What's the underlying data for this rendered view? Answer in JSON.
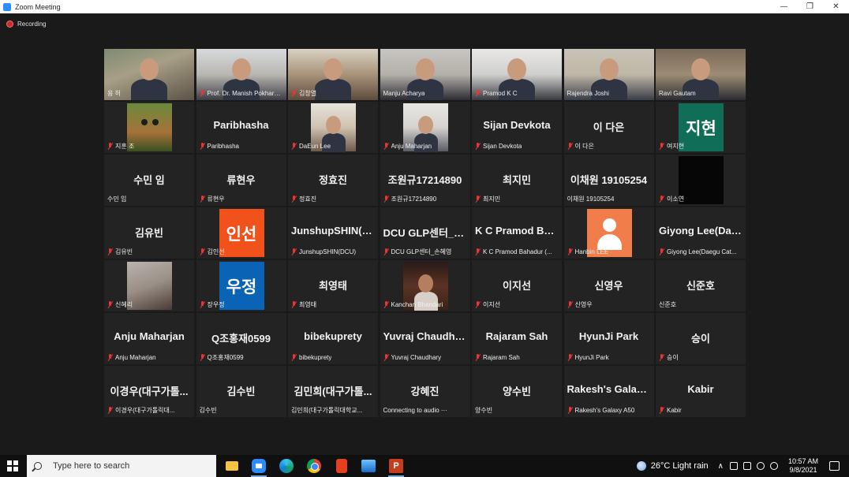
{
  "window": {
    "title": "Zoom Meeting",
    "minimize": "—",
    "restore": "❐",
    "close": "✕"
  },
  "recording": {
    "label": "Recording"
  },
  "participants": [
    {
      "name": "용 허",
      "big": "",
      "muted": false,
      "video": "v1",
      "active": true
    },
    {
      "name": "Prof. Dr. Manish Pokharel...",
      "big": "",
      "muted": true,
      "video": "v2"
    },
    {
      "name": "김창열",
      "big": "",
      "muted": true,
      "video": "v3"
    },
    {
      "name": "Manju Acharya",
      "big": "",
      "muted": false,
      "video": "v4"
    },
    {
      "name": "Pramod K C",
      "big": "",
      "muted": true,
      "video": "v5"
    },
    {
      "name": "Rajendra Joshi",
      "big": "",
      "muted": false,
      "video": "v6"
    },
    {
      "name": "Ravi Gautam",
      "big": "",
      "muted": false,
      "video": "v7"
    },
    {
      "name": "지훈 조",
      "big": "",
      "muted": true,
      "thumb": "zoot"
    },
    {
      "name": "Paribhasha",
      "big": "Paribhasha",
      "muted": true
    },
    {
      "name": "DaEun Lee",
      "big": "",
      "muted": true,
      "thumb": "daeun"
    },
    {
      "name": "Anju Maharjan",
      "big": "",
      "muted": true,
      "thumb": "anju"
    },
    {
      "name": "Sijan Devkota",
      "big": "Sijan Devkota",
      "muted": true
    },
    {
      "name": "이 다은",
      "big": "이 다은",
      "muted": true
    },
    {
      "name": "여지현",
      "big": "",
      "muted": true,
      "thumb": "jihyun",
      "thumb_text": "지현"
    },
    {
      "name": "수민 임",
      "big": "수민 임",
      "muted": false
    },
    {
      "name": "류현우",
      "big": "류현우",
      "muted": true
    },
    {
      "name": "정효진",
      "big": "정효진",
      "muted": true
    },
    {
      "name": "조원규17214890",
      "big": "조원규17214890",
      "muted": true
    },
    {
      "name": "최지민",
      "big": "최지민",
      "muted": true
    },
    {
      "name": "이채원 19105254",
      "big": "이채원 19105254",
      "muted": false
    },
    {
      "name": "이소연",
      "big": "",
      "muted": true,
      "thumb": "black"
    },
    {
      "name": "김유빈",
      "big": "김유빈",
      "muted": true
    },
    {
      "name": "김인선",
      "big": "",
      "muted": true,
      "thumb": "inseon",
      "thumb_text": "인선"
    },
    {
      "name": "JunshupSHIN(DCU)",
      "big": "JunshupSHIN(D...",
      "muted": true
    },
    {
      "name": "DCU GLP센터_손혜영",
      "big": "DCU GLP센터_손...",
      "muted": true
    },
    {
      "name": "K C Pramod Bahadur (...",
      "big": "K C Pramod Bah...",
      "muted": true
    },
    {
      "name": "Hanbin LEE",
      "big": "",
      "muted": true,
      "thumb": "hanbin"
    },
    {
      "name": "Giyong Lee(Daegu Cat...",
      "big": "Giyong Lee(Dae...",
      "muted": true
    },
    {
      "name": "신혜리",
      "big": "",
      "muted": true,
      "thumb": "shinhye"
    },
    {
      "name": "장우정",
      "big": "",
      "muted": true,
      "thumb": "ujeong",
      "thumb_text": "우정"
    },
    {
      "name": "최영태",
      "big": "최영태",
      "muted": true
    },
    {
      "name": "Kanchan Bhandari",
      "big": "",
      "muted": true,
      "thumb": "kanchan"
    },
    {
      "name": "이지선",
      "big": "이지선",
      "muted": true
    },
    {
      "name": "신영우",
      "big": "신영우",
      "muted": true
    },
    {
      "name": "신준호",
      "big": "신준호",
      "muted": false
    },
    {
      "name": "Anju Maharjan",
      "big": "Anju Maharjan",
      "muted": true
    },
    {
      "name": "Q조홍재0599",
      "big": "Q조홍재0599",
      "muted": true
    },
    {
      "name": "bibekuprety",
      "big": "bibekuprety",
      "muted": true
    },
    {
      "name": "Yuvraj Chaudhary",
      "big": "Yuvraj Chaudhary",
      "muted": true
    },
    {
      "name": "Rajaram Sah",
      "big": "Rajaram Sah",
      "muted": true
    },
    {
      "name": "HyunJi Park",
      "big": "HyunJi Park",
      "muted": true
    },
    {
      "name": "승이",
      "big": "승이",
      "muted": true
    },
    {
      "name": "이경우(대구가톨릭대...",
      "big": "이경우(대구가톨...",
      "muted": true
    },
    {
      "name": "김수빈",
      "big": "김수빈",
      "muted": false
    },
    {
      "name": "김민희(대구가톨릭대학교...",
      "big": "김민희(대구가톨...",
      "muted": false
    },
    {
      "name": "Connecting to audio ···",
      "big": "강혜진",
      "muted": false
    },
    {
      "name": "양수빈",
      "big": "양수빈",
      "muted": false
    },
    {
      "name": "Rakesh's Galaxy A50",
      "big": "Rakesh's Galaxy...",
      "muted": true
    },
    {
      "name": "Kabir",
      "big": "Kabir",
      "muted": true
    }
  ],
  "taskbar": {
    "search_placeholder": "Type here to search",
    "ppt_letter": "P",
    "weather": "26°C  Light rain",
    "chevron": "∧",
    "time": "10:57 AM",
    "date": "9/8/2021"
  },
  "colors": {
    "active_speaker": "#c3e33b",
    "muted_icon": "#ee3333",
    "tile_bg": "#232323",
    "meeting_bg": "#1a1a1a"
  }
}
